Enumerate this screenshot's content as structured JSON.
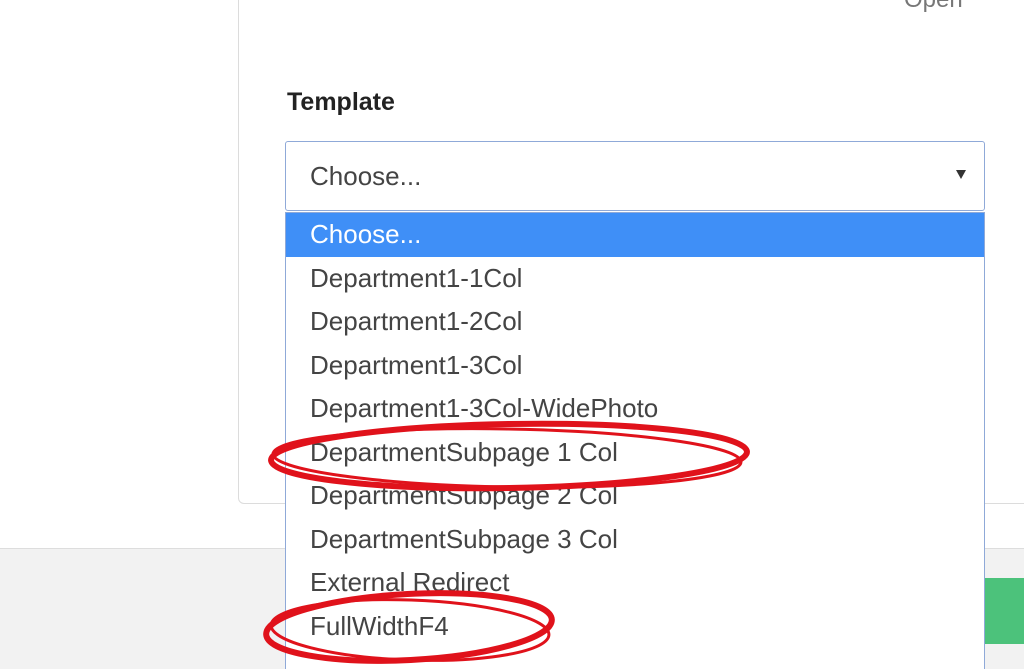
{
  "card": {
    "top_right_text": "Open"
  },
  "template_field": {
    "label": "Template",
    "selected_value": "Choose...",
    "options": [
      "Choose...",
      "Department1-1Col",
      "Department1-2Col",
      "Department1-3Col",
      "Department1-3Col-WidePhoto",
      "DepartmentSubpage 1 Col",
      "DepartmentSubpage 2 Col",
      "DepartmentSubpage 3 Col",
      "External Redirect",
      "FullWidthF4"
    ],
    "highlighted_option_index": 0
  },
  "annotations": {
    "ellipse_color": "#e0121b",
    "circled_options": [
      "DepartmentSubpage 1 Col",
      "FullWidthF4"
    ]
  },
  "colors": {
    "selected_option_bg": "#3f8ff7",
    "select_border": "#8fa9d8",
    "save_button": "#4cc27b"
  }
}
